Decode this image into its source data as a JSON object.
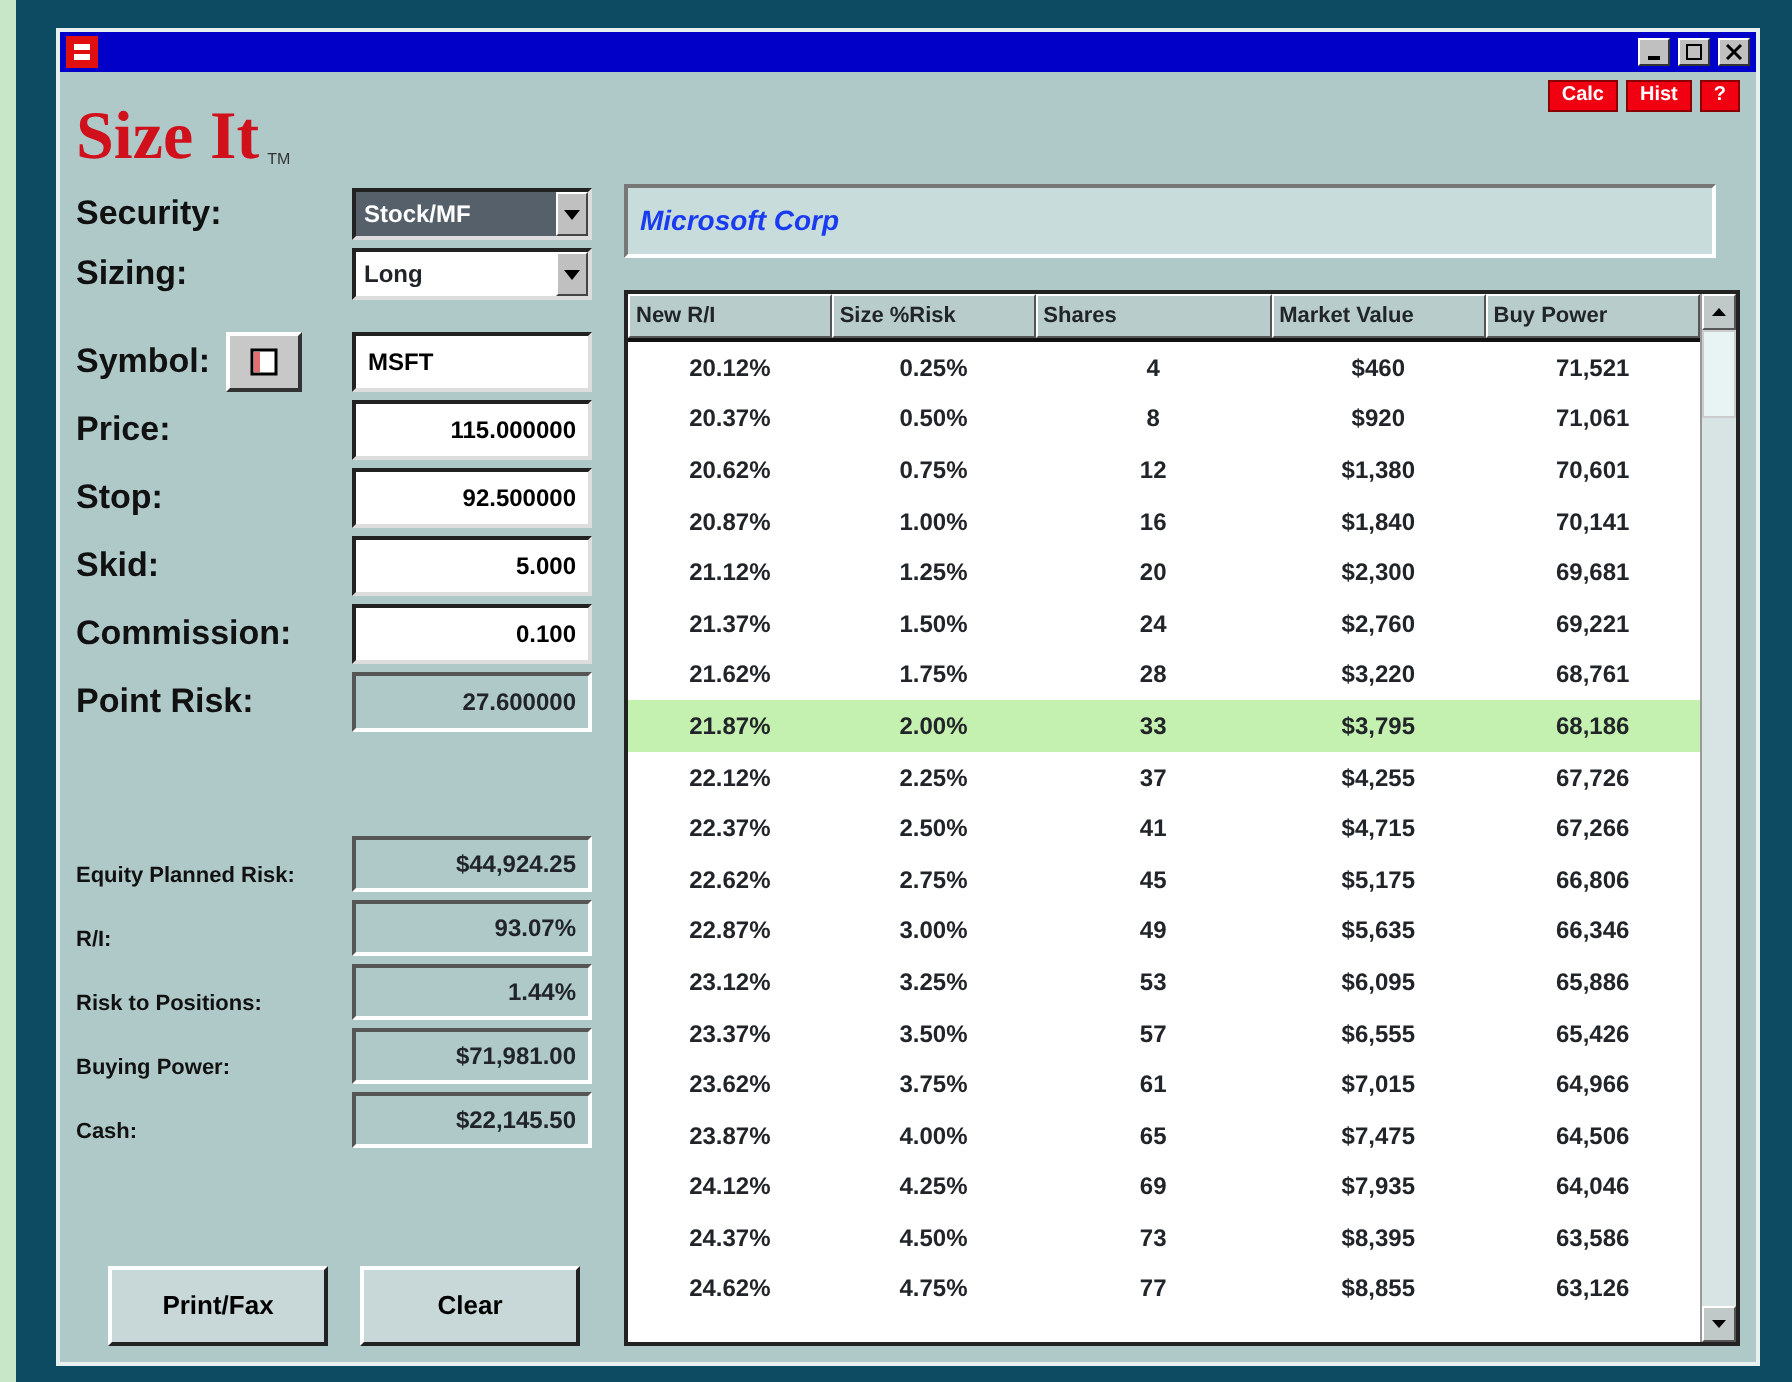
{
  "toolbar_buttons": [
    "Calc",
    "Hist",
    "?"
  ],
  "logo": {
    "text": "Size It",
    "mark": "TM"
  },
  "form": [
    {
      "kind": "select",
      "label": "Security:",
      "value": "Stock/MF",
      "selected": true
    },
    {
      "kind": "select",
      "label": "Sizing:",
      "value": "Long",
      "selected": false
    },
    {
      "kind": "symbol",
      "label": "Symbol:",
      "value": "MSFT"
    },
    {
      "kind": "input",
      "label": "Price:",
      "value": "115.000000"
    },
    {
      "kind": "input",
      "label": "Stop:",
      "value": "92.500000"
    },
    {
      "kind": "input",
      "label": "Skid:",
      "value": "5.000"
    },
    {
      "kind": "input",
      "label": "Commission:",
      "value": "0.100"
    },
    {
      "kind": "readout",
      "label": "Point Risk:",
      "value": "27.600000"
    }
  ],
  "summary": [
    {
      "label": "Equity Planned Risk:",
      "value": "$44,924.25"
    },
    {
      "label": "R/I:",
      "value": "93.07%"
    },
    {
      "label": "Risk to Positions:",
      "value": "1.44%"
    },
    {
      "label": "Buying Power:",
      "value": "$71,981.00"
    },
    {
      "label": "Cash:",
      "value": "$22,145.50"
    }
  ],
  "buttons": [
    "Print/Fax",
    "Clear"
  ],
  "company": "Microsoft Corp",
  "table": {
    "columns": [
      "New R/I",
      "Size %Risk",
      "Shares",
      "Market Value",
      "Buy Power"
    ],
    "rows": [
      {
        "cells": [
          "20.12%",
          "0.25%",
          "4",
          "$460",
          "71,521"
        ],
        "selected": false
      },
      {
        "cells": [
          "20.37%",
          "0.50%",
          "8",
          "$920",
          "71,061"
        ],
        "selected": false
      },
      {
        "cells": [
          "20.62%",
          "0.75%",
          "12",
          "$1,380",
          "70,601"
        ],
        "selected": false
      },
      {
        "cells": [
          "20.87%",
          "1.00%",
          "16",
          "$1,840",
          "70,141"
        ],
        "selected": false
      },
      {
        "cells": [
          "21.12%",
          "1.25%",
          "20",
          "$2,300",
          "69,681"
        ],
        "selected": false
      },
      {
        "cells": [
          "21.37%",
          "1.50%",
          "24",
          "$2,760",
          "69,221"
        ],
        "selected": false
      },
      {
        "cells": [
          "21.62%",
          "1.75%",
          "28",
          "$3,220",
          "68,761"
        ],
        "selected": false
      },
      {
        "cells": [
          "21.87%",
          "2.00%",
          "33",
          "$3,795",
          "68,186"
        ],
        "selected": true
      },
      {
        "cells": [
          "22.12%",
          "2.25%",
          "37",
          "$4,255",
          "67,726"
        ],
        "selected": false
      },
      {
        "cells": [
          "22.37%",
          "2.50%",
          "41",
          "$4,715",
          "67,266"
        ],
        "selected": false
      },
      {
        "cells": [
          "22.62%",
          "2.75%",
          "45",
          "$5,175",
          "66,806"
        ],
        "selected": false
      },
      {
        "cells": [
          "22.87%",
          "3.00%",
          "49",
          "$5,635",
          "66,346"
        ],
        "selected": false
      },
      {
        "cells": [
          "23.12%",
          "3.25%",
          "53",
          "$6,095",
          "65,886"
        ],
        "selected": false
      },
      {
        "cells": [
          "23.37%",
          "3.50%",
          "57",
          "$6,555",
          "65,426"
        ],
        "selected": false
      },
      {
        "cells": [
          "23.62%",
          "3.75%",
          "61",
          "$7,015",
          "64,966"
        ],
        "selected": false
      },
      {
        "cells": [
          "23.87%",
          "4.00%",
          "65",
          "$7,475",
          "64,506"
        ],
        "selected": false
      },
      {
        "cells": [
          "24.12%",
          "4.25%",
          "69",
          "$7,935",
          "64,046"
        ],
        "selected": false
      },
      {
        "cells": [
          "24.37%",
          "4.50%",
          "73",
          "$8,395",
          "63,586"
        ],
        "selected": false
      },
      {
        "cells": [
          "24.62%",
          "4.75%",
          "77",
          "$8,855",
          "63,126"
        ],
        "selected": false
      }
    ]
  }
}
